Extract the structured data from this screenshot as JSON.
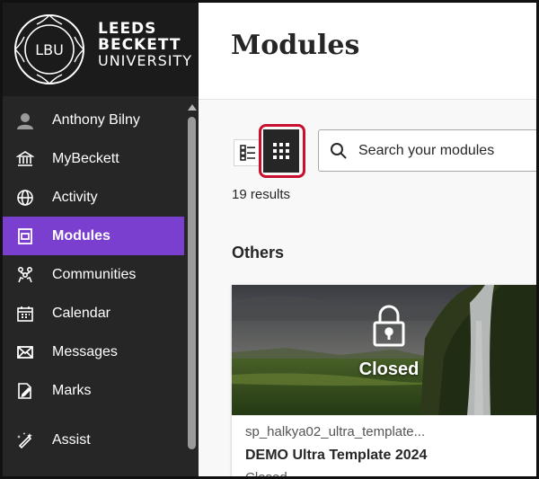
{
  "brand": {
    "seal_text": "LBU",
    "line1": "LEEDS",
    "line2": "BECKETT",
    "line3": "UNIVERSITY"
  },
  "nav": {
    "items": [
      {
        "label": "Anthony Bilny",
        "icon": "user-avatar-icon"
      },
      {
        "label": "MyBeckett",
        "icon": "institution-icon"
      },
      {
        "label": "Activity",
        "icon": "globe-icon"
      },
      {
        "label": "Modules",
        "icon": "modules-icon",
        "active": true
      },
      {
        "label": "Communities",
        "icon": "communities-icon"
      },
      {
        "label": "Calendar",
        "icon": "calendar-icon"
      },
      {
        "label": "Messages",
        "icon": "envelope-icon"
      },
      {
        "label": "Marks",
        "icon": "marks-icon"
      },
      {
        "label": "Assist",
        "icon": "assist-icon"
      }
    ]
  },
  "page": {
    "title": "Modules",
    "results": "19 results",
    "section": "Others"
  },
  "search": {
    "placeholder": "Search your modules"
  },
  "view_toggle": {
    "list_icon": "list-view-icon",
    "grid_icon": "grid-view-icon",
    "selected": "grid"
  },
  "card": {
    "overlay_label": "Closed",
    "code": "sp_halkya02_ultra_template...",
    "name": "DEMO Ultra Template 2024",
    "status": "Closed"
  },
  "colors": {
    "sidebar": "#262626",
    "active": "#7b3fd0",
    "highlight_ring": "#c8102e"
  }
}
